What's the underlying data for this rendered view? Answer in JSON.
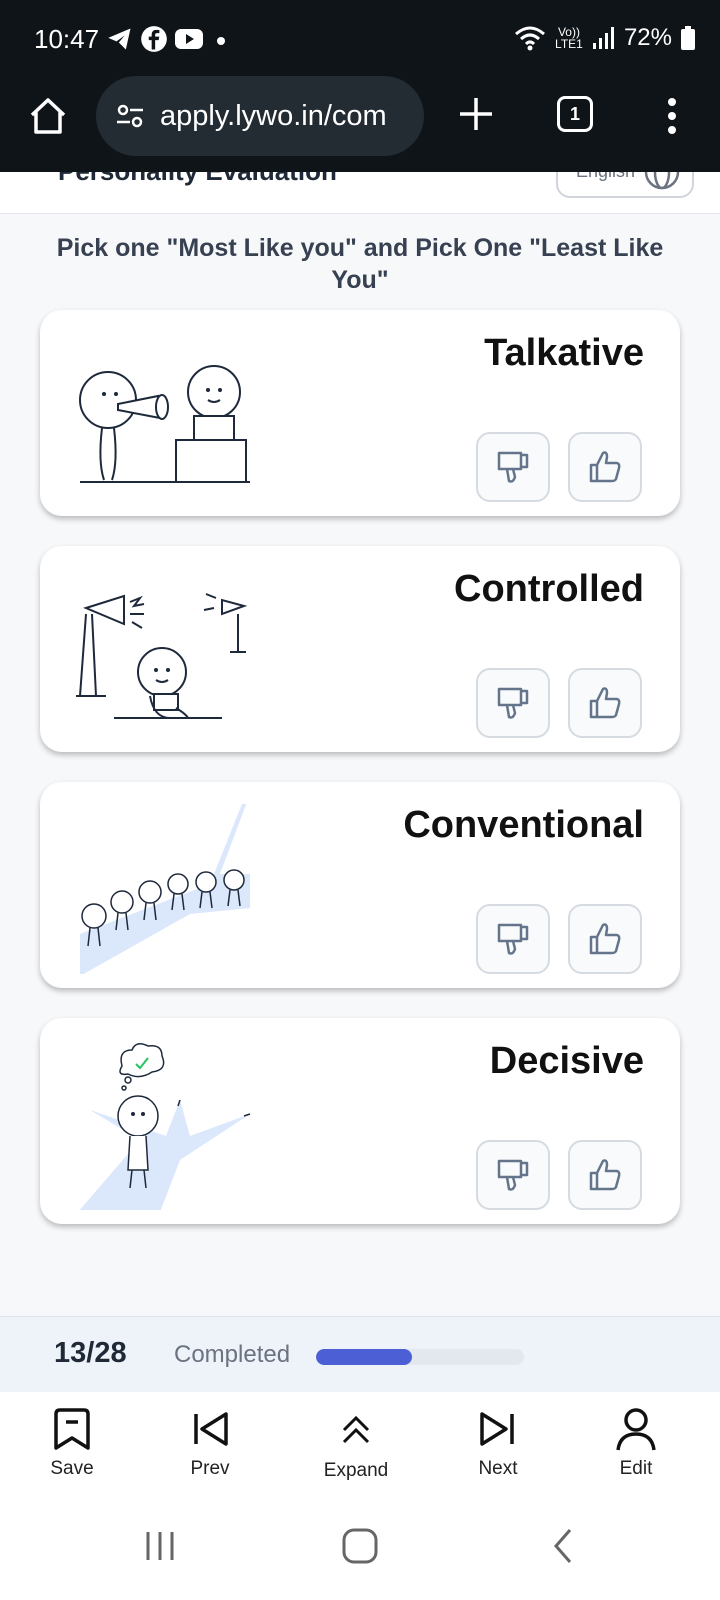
{
  "status_bar": {
    "time": "10:47",
    "battery": "72%",
    "network_label": "Vo)) LTE1"
  },
  "browser": {
    "url": "apply.lywo.in/com",
    "tab_count": "1"
  },
  "page_header": {
    "title": "Personality Evaluation",
    "language": "English"
  },
  "instruction": "Pick one \"Most Like you\" and Pick One \"Least Like You\"",
  "cards": [
    {
      "title": "Talkative",
      "illustration": "person-with-megaphone-illustration"
    },
    {
      "title": "Controlled",
      "illustration": "calm-person-with-speakers-illustration"
    },
    {
      "title": "Conventional",
      "illustration": "people-in-line-illustration"
    },
    {
      "title": "Decisive",
      "illustration": "person-thinking-paths-illustration"
    }
  ],
  "progress": {
    "count": "13/28",
    "label": "Completed",
    "fraction": 0.46
  },
  "bottom_nav": {
    "save": "Save",
    "prev": "Prev",
    "expand": "Expand",
    "next": "Next",
    "edit": "Edit"
  },
  "colors": {
    "accent": "#4c5fd5",
    "status_bar_bg": "#0f1419",
    "illustration_fill": "#dbe7fb"
  }
}
